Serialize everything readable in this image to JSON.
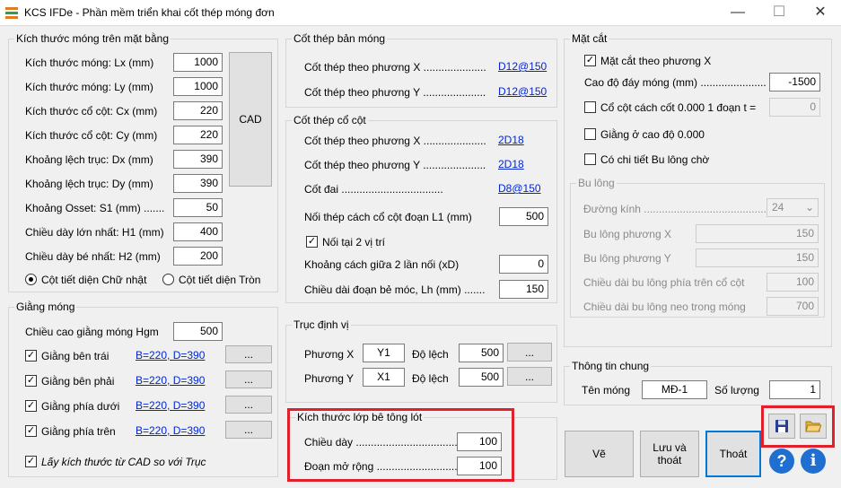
{
  "window": {
    "title": "KCS IFDe - Phần mềm triển khai cốt thép móng đơn",
    "min": "—",
    "max": "☐",
    "close": "✕"
  },
  "footing": {
    "title": "Kích thước móng trên mặt bằng",
    "rows": [
      {
        "label": "Kích thước móng: Lx (mm)",
        "value": "1000"
      },
      {
        "label": "Kích thước móng: Ly (mm)",
        "value": "1000"
      },
      {
        "label": "Kích thước cổ cột: Cx (mm)",
        "value": "220"
      },
      {
        "label": "Kích thước cổ cột: Cy (mm)",
        "value": "220"
      },
      {
        "label": "Khoảng lệch trục: Dx (mm)",
        "value": "390"
      },
      {
        "label": "Khoảng lệch trục: Dy (mm)",
        "value": "390"
      },
      {
        "label": "Khoảng Osset: S1 (mm) .......",
        "value": "50"
      },
      {
        "label": "Chiều dày lớn nhất: H1 (mm)",
        "value": "400"
      },
      {
        "label": "Chiều dày bé nhất: H2 (mm)",
        "value": "200"
      }
    ],
    "cad": "CAD",
    "radio_rect": "Cột tiết diện Chữ nhật",
    "radio_round": "Cột tiết diện Tròn"
  },
  "beam": {
    "title": "Giằng móng",
    "height_label": "Chiều cao giằng móng Hgm",
    "height_value": "500",
    "rows": [
      {
        "label": "Giằng bên trái",
        "link": "B=220, D=390",
        "btn": "..."
      },
      {
        "label": "Giằng bên phải",
        "link": "B=220, D=390",
        "btn": "..."
      },
      {
        "label": "Giằng phía dưới",
        "link": "B=220, D=390",
        "btn": "..."
      },
      {
        "label": "Giằng phía trên",
        "link": "B=220, D=390",
        "btn": "..."
      }
    ],
    "cad_check": "Lấy kích thước từ CAD so với Trục"
  },
  "slab_rebar": {
    "title": "Cốt thép bản móng",
    "x_label": "Cốt thép theo phương X .....................",
    "x_link": "D12@150",
    "y_label": "Cốt thép theo phương Y .....................",
    "y_link": "D12@150"
  },
  "col_rebar": {
    "title": "Cốt thép cổ cột",
    "x_label": "Cốt thép theo phương X .....................",
    "x_link": "2D18",
    "y_label": "Cốt thép theo phương Y .....................",
    "y_link": "2D18",
    "s_label": "Cốt   đai   ..................................",
    "s_link": "D8@150",
    "l1_label": "Nối thép cách cổ cột đoạn L1 (mm)",
    "l1_value": "500",
    "two_label": "Nối tại 2 vị trí",
    "xd_label": "Khoảng cách giữa 2 lần nối (xD)",
    "xd_value": "0",
    "lh_label": "Chiều dài đoạn bẻ móc, Lh (mm) .......",
    "lh_value": "150"
  },
  "axis": {
    "title": "Trục định vị",
    "x_label": "Phương X",
    "x_axis": "Y1",
    "x_off_label": "Độ lệch",
    "x_off": "500",
    "x_btn": "...",
    "y_label": "Phương Y",
    "y_axis": "X1",
    "y_off_label": "Độ lệch",
    "y_off": "500",
    "y_btn": "..."
  },
  "lean": {
    "title": "Kích thước lớp bê tông lót",
    "thk_label": "Chiều  dày  .......................................",
    "thk_value": "100",
    "ext_label": "Đoạn mở rộng  ...................................",
    "ext_value": "100"
  },
  "section": {
    "title": "Mặt cắt",
    "x_check": "Mặt cắt theo phương X",
    "bottom_label": "Cao độ đáy móng (mm) ......................",
    "bottom_value": "-1500",
    "col_check": "Cổ cột cách cốt 0.000 1 đoạn t =",
    "col_value": "0",
    "beam_check": "Giằng ở cao độ 0.000",
    "bolt_check": "Có chi tiết Bu lông chờ",
    "bolt": {
      "title": "Bu lông",
      "dia_label": "Đường  kính  ..............................................",
      "dia_value": "24",
      "x_label": "Bu lông phương X",
      "x_value": "150",
      "y_label": "Bu lông phương Y",
      "y_value": "150",
      "top_label": "Chiều dài bu lông phía trên cổ cột",
      "top_value": "100",
      "anchor_label": "Chiều dài bu lông neo trong móng",
      "anchor_value": "700"
    }
  },
  "general": {
    "title": "Thông tin chung",
    "name_label": "Tên móng",
    "name_value": "MĐ-1",
    "qty_label": "Số lượng",
    "qty_value": "1"
  },
  "actions": {
    "draw": "Vẽ",
    "save_exit": "Lưu và\nthoát",
    "exit": "Thoát",
    "help": "?",
    "info": "i"
  },
  "colors": {
    "accent": "#0026d6",
    "highlight": "#e0202a",
    "help_blue": "#1e6fd0"
  }
}
